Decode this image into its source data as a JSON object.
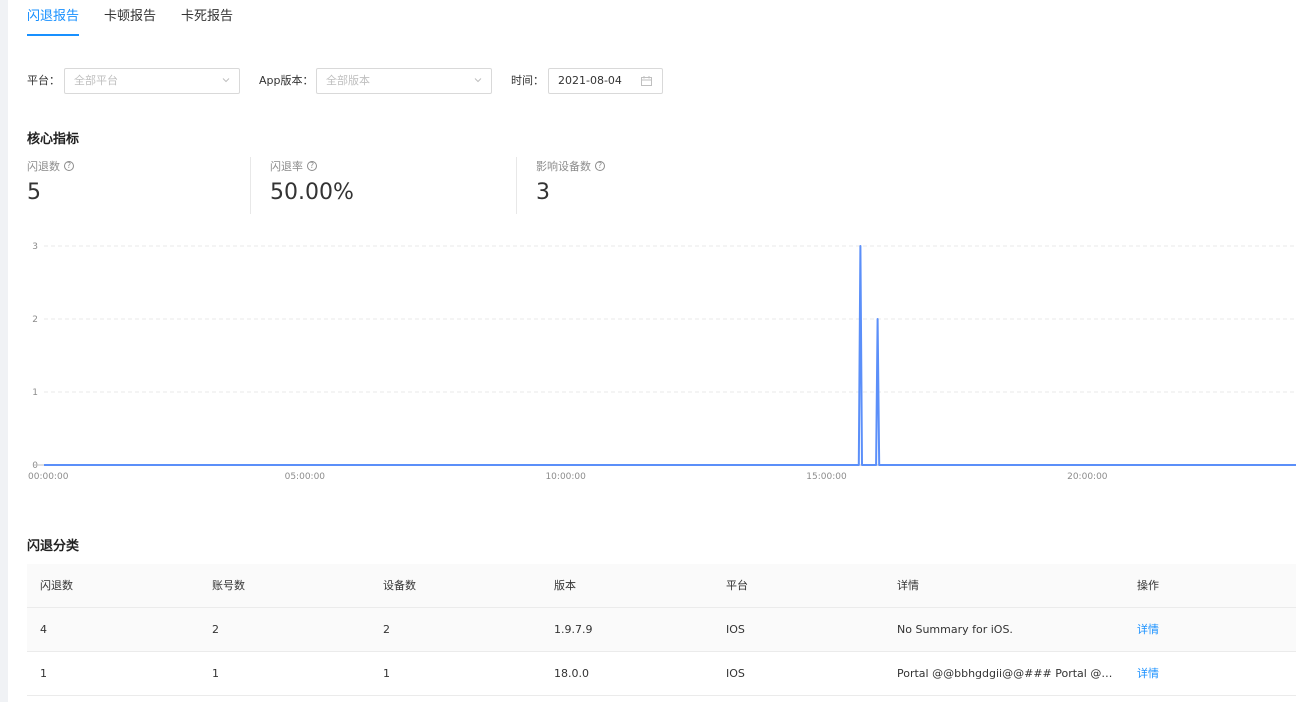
{
  "tabs": [
    {
      "label": "闪退报告",
      "active": true
    },
    {
      "label": "卡顿报告",
      "active": false
    },
    {
      "label": "卡死报告",
      "active": false
    }
  ],
  "filters": {
    "platform_label": "平台：",
    "platform_placeholder": "全部平台",
    "version_label": "App版本：",
    "version_placeholder": "全部版本",
    "time_label": "时间：",
    "time_value": "2021-08-04"
  },
  "core": {
    "title": "核心指标",
    "metrics": [
      {
        "label": "闪退数",
        "value": "5"
      },
      {
        "label": "闪退率",
        "value": "50.00%"
      },
      {
        "label": "影响设备数",
        "value": "3"
      }
    ]
  },
  "chart_data": {
    "type": "line",
    "x_ticks": [
      "00:00:00",
      "05:00:00",
      "10:00:00",
      "15:00:00",
      "20:00:00"
    ],
    "y_ticks": [
      0,
      1,
      2,
      3
    ],
    "ylim": [
      0,
      3
    ],
    "xlim_hours": [
      0,
      24
    ],
    "grid": true,
    "color": "#5b8ff9",
    "series": [
      {
        "points": [
          {
            "hour": 0,
            "value": 0
          },
          {
            "hour": 15.62,
            "value": 0
          },
          {
            "hour": 15.65,
            "value": 3
          },
          {
            "hour": 15.68,
            "value": 0
          },
          {
            "hour": 15.95,
            "value": 0
          },
          {
            "hour": 15.98,
            "value": 2
          },
          {
            "hour": 16.01,
            "value": 0
          },
          {
            "hour": 24,
            "value": 0
          }
        ]
      }
    ]
  },
  "classify": {
    "title": "闪退分类",
    "columns": [
      "闪退数",
      "账号数",
      "设备数",
      "版本",
      "平台",
      "详情",
      "操作"
    ],
    "rows": [
      {
        "crashes": "4",
        "accounts": "2",
        "devices": "2",
        "version": "1.9.7.9",
        "platform": "IOS",
        "detail": "No Summary for iOS.",
        "action": "详情"
      },
      {
        "crashes": "1",
        "accounts": "1",
        "devices": "1",
        "version": "18.0.0",
        "platform": "IOS",
        "detail": "Portal @@bbhgdgii@@### Portal @@cj...",
        "action": "详情"
      }
    ]
  }
}
